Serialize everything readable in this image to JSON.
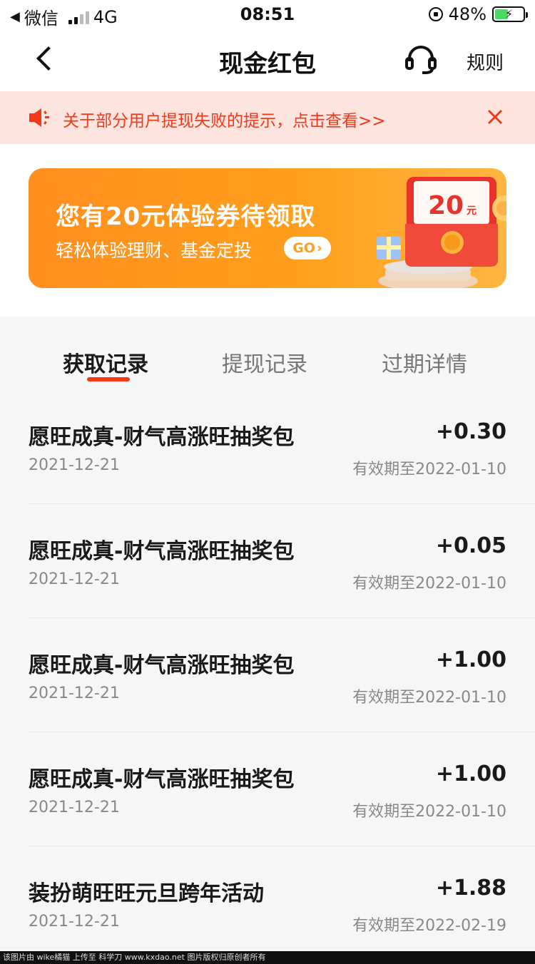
{
  "status_bar": {
    "back_app": "微信",
    "network": "4G",
    "time": "08:51",
    "battery_percent": "48%",
    "battery_level": 0.48
  },
  "nav": {
    "title": "现金红包",
    "rules_label": "规则"
  },
  "notice": {
    "text": "关于部分用户提现失败的提示，点击查看>>"
  },
  "banner": {
    "title": "您有20元体验券待领取",
    "subtitle": "轻松体验理财、基金定投",
    "go_label": "GO",
    "coupon_value": "20",
    "coupon_unit": "元"
  },
  "tabs": [
    {
      "label": "获取记录",
      "active": true
    },
    {
      "label": "提现记录",
      "active": false
    },
    {
      "label": "过期详情",
      "active": false
    }
  ],
  "records": [
    {
      "title": "愿旺成真-财气高涨旺抽奖包",
      "amount": "+0.30",
      "date": "2021-12-21",
      "expiry": "有效期至2022-01-10"
    },
    {
      "title": "愿旺成真-财气高涨旺抽奖包",
      "amount": "+0.05",
      "date": "2021-12-21",
      "expiry": "有效期至2022-01-10"
    },
    {
      "title": "愿旺成真-财气高涨旺抽奖包",
      "amount": "+1.00",
      "date": "2021-12-21",
      "expiry": "有效期至2022-01-10"
    },
    {
      "title": "愿旺成真-财气高涨旺抽奖包",
      "amount": "+1.00",
      "date": "2021-12-21",
      "expiry": "有效期至2022-01-10"
    },
    {
      "title": "装扮萌旺旺元旦跨年活动",
      "amount": "+1.88",
      "date": "2021-12-21",
      "expiry": "有效期至2022-02-19"
    }
  ],
  "watermark": "该图片由 wike橘猫 上传至 科学刀 www.kxdao.net 图片版权归原创者所有",
  "colors": {
    "accent": "#f23a1b",
    "notice_bg": "#fde4df",
    "banner_orange": "#ff9e1c"
  }
}
